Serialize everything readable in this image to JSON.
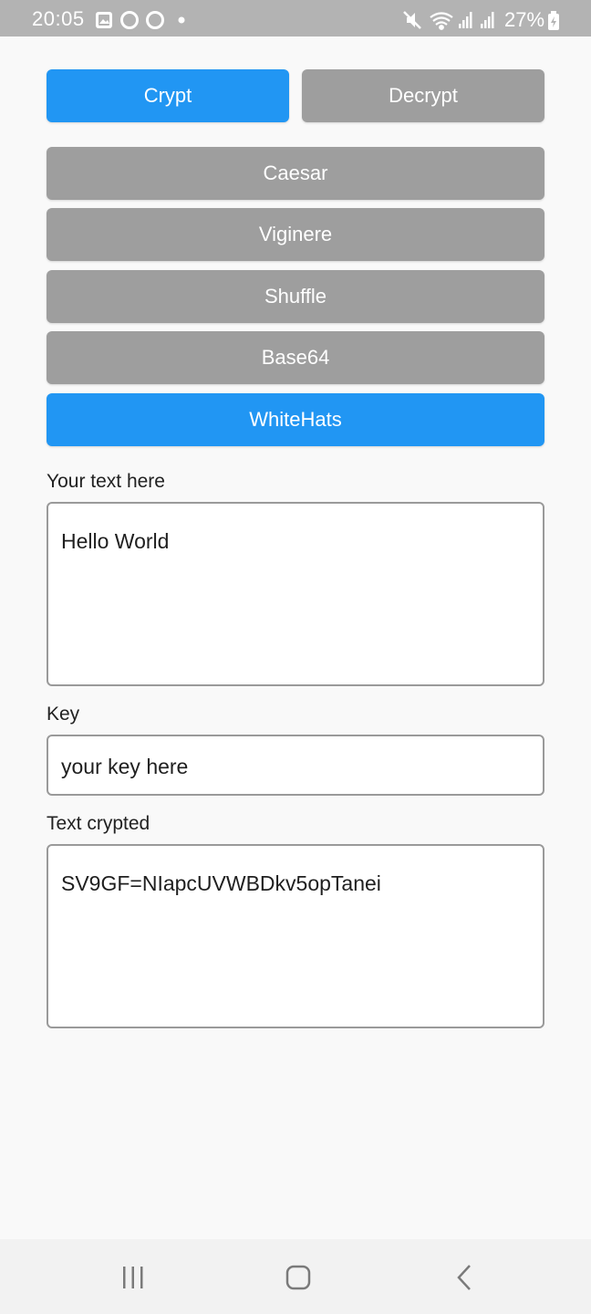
{
  "status_bar": {
    "time": "20:05",
    "battery": "27%",
    "left_icons": [
      "gallery-icon",
      "circle-icon",
      "circle-icon",
      "dot-icon"
    ],
    "right_icons": [
      "mute-icon",
      "wifi-icon",
      "signal-icon",
      "signal-icon",
      "battery-icon"
    ]
  },
  "mode_tabs": {
    "crypt": "Crypt",
    "decrypt": "Decrypt"
  },
  "algorithms": [
    {
      "label": "Caesar",
      "active": false
    },
    {
      "label": "Viginere",
      "active": false
    },
    {
      "label": "Shuffle",
      "active": false
    },
    {
      "label": "Base64",
      "active": false
    },
    {
      "label": "WhiteHats",
      "active": true
    }
  ],
  "input": {
    "label": "Your text here",
    "value": "Hello World"
  },
  "key": {
    "label": "Key",
    "placeholder": "your key here"
  },
  "output": {
    "label": "Text crypted",
    "value": "SV9GF=NIapcUVWBDkv5opTanei"
  },
  "colors": {
    "active": "#2196f3",
    "inactive": "#9e9e9e"
  },
  "nav_bar": {
    "icons": [
      "recents-icon",
      "home-icon",
      "back-icon"
    ]
  }
}
